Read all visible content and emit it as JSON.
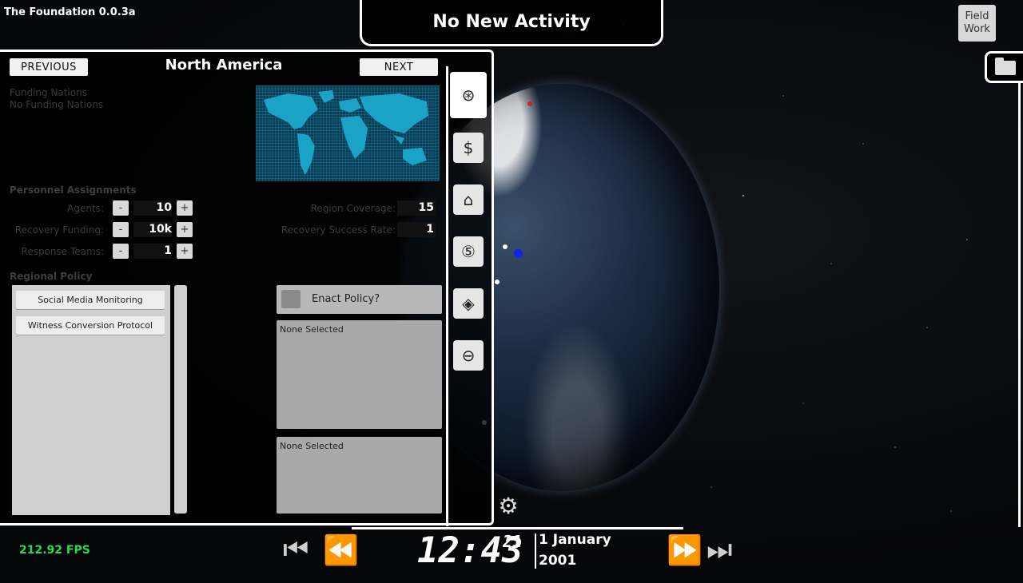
{
  "app": {
    "version_label": "The Foundation 0.0.3a",
    "fps": "212.92 FPS"
  },
  "activity": {
    "text": "No New Activity"
  },
  "field_work": {
    "label_line1": "Field",
    "label_line2": "Work"
  },
  "panel": {
    "title": "North America",
    "previous_label": "PREVIOUS",
    "next_label": "NEXT",
    "funding_nations_label": "Funding Nations",
    "funding_nations_value": "No Funding Nations",
    "personnel_heading": "Personnel Assignments",
    "personnel": [
      {
        "label": "Agents:",
        "value": "10"
      },
      {
        "label": "Recovery Funding:",
        "value": "10k"
      },
      {
        "label": "Response Teams:",
        "value": "1"
      }
    ],
    "coverage": [
      {
        "label": "Region Coverage:",
        "value": "15"
      },
      {
        "label": "Recovery Success Rate:",
        "value": "1"
      }
    ],
    "minus_label": "-",
    "plus_label": "+",
    "policy_heading": "Regional Policy",
    "policies": [
      "Social Media Monitoring",
      "Witness Conversion Protocol"
    ],
    "enact_label": "Enact Policy?",
    "selection_1": "None Selected",
    "selection_2": "None Selected"
  },
  "tabs": [
    {
      "icon": "foundation-logo-icon",
      "glyph": "⊛"
    },
    {
      "icon": "dollar-icon",
      "glyph": "$"
    },
    {
      "icon": "building-icon",
      "glyph": "⌂"
    },
    {
      "icon": "number-five-icon",
      "glyph": "⑤"
    },
    {
      "icon": "diamond-icon",
      "glyph": "◈"
    },
    {
      "icon": "globe-icon",
      "glyph": "⊖"
    }
  ],
  "time": {
    "clock": "12:43",
    "seconds": "21",
    "date_line1": "1 January",
    "date_line2": "2001"
  },
  "colors": {
    "map_land": "#1aa3c7",
    "fps_green": "#22dd55",
    "marker_blue": "#1122ee",
    "marker_red": "#cc2222"
  }
}
